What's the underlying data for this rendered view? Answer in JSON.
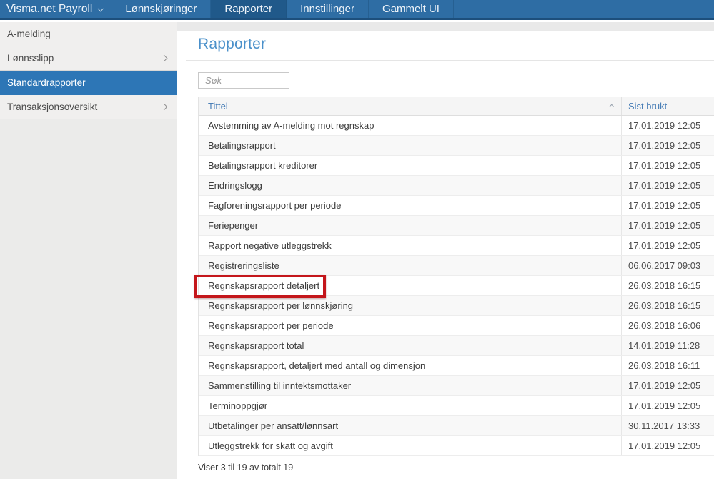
{
  "nav": {
    "brand": "Visma.net Payroll",
    "items": [
      {
        "label": "Lønnskjøringer",
        "active": false
      },
      {
        "label": "Rapporter",
        "active": true
      },
      {
        "label": "Innstillinger",
        "active": false
      },
      {
        "label": "Gammelt UI",
        "active": false
      }
    ]
  },
  "sidebar": {
    "items": [
      {
        "label": "A-melding",
        "selected": false,
        "has_submenu": false
      },
      {
        "label": "Lønnsslipp",
        "selected": false,
        "has_submenu": true
      },
      {
        "label": "Standardrapporter",
        "selected": true,
        "has_submenu": false
      },
      {
        "label": "Transaksjonsoversikt",
        "selected": false,
        "has_submenu": true
      }
    ]
  },
  "main": {
    "title": "Rapporter",
    "search": {
      "placeholder": "Søk",
      "value": ""
    },
    "table": {
      "columns": [
        {
          "label": "Tittel",
          "sort": "asc"
        },
        {
          "label": "Sist brukt",
          "sort": null
        }
      ],
      "rows": [
        {
          "title": "Avstemming av A-melding mot regnskap",
          "last_used": "17.01.2019 12:05",
          "highlighted": false
        },
        {
          "title": "Betalingsrapport",
          "last_used": "17.01.2019 12:05",
          "highlighted": false
        },
        {
          "title": "Betalingsrapport kreditorer",
          "last_used": "17.01.2019 12:05",
          "highlighted": false
        },
        {
          "title": "Endringslogg",
          "last_used": "17.01.2019 12:05",
          "highlighted": false
        },
        {
          "title": "Fagforeningsrapport per periode",
          "last_used": "17.01.2019 12:05",
          "highlighted": false
        },
        {
          "title": "Feriepenger",
          "last_used": "17.01.2019 12:05",
          "highlighted": false
        },
        {
          "title": "Rapport negative utleggstrekk",
          "last_used": "17.01.2019 12:05",
          "highlighted": false
        },
        {
          "title": "Registreringsliste",
          "last_used": "06.06.2017 09:03",
          "highlighted": false
        },
        {
          "title": "Regnskapsrapport detaljert",
          "last_used": "26.03.2018 16:15",
          "highlighted": true
        },
        {
          "title": "Regnskapsrapport per lønnskjøring",
          "last_used": "26.03.2018 16:15",
          "highlighted": false
        },
        {
          "title": "Regnskapsrapport per periode",
          "last_used": "26.03.2018 16:06",
          "highlighted": false
        },
        {
          "title": "Regnskapsrapport total",
          "last_used": "14.01.2019 11:28",
          "highlighted": false
        },
        {
          "title": "Regnskapsrapport, detaljert med antall og dimensjon",
          "last_used": "26.03.2018 16:11",
          "highlighted": false
        },
        {
          "title": "Sammenstilling til inntektsmottaker",
          "last_used": "17.01.2019 12:05",
          "highlighted": false
        },
        {
          "title": "Terminoppgjør",
          "last_used": "17.01.2019 12:05",
          "highlighted": false
        },
        {
          "title": "Utbetalinger per ansatt/lønnsart",
          "last_used": "30.11.2017 13:33",
          "highlighted": false
        },
        {
          "title": "Utleggstrekk for skatt og avgift",
          "last_used": "17.01.2019 12:05",
          "highlighted": false
        }
      ]
    },
    "footer": "Viser 3 til 19 av totalt 19"
  },
  "colors": {
    "nav_background": "#2e6da4",
    "nav_active_tab": "#20598a",
    "sidebar_selected": "#2d76b6",
    "title_blue": "#4a90ca",
    "table_header_blue": "#4a7fb7",
    "highlight_red": "#c4161b"
  }
}
